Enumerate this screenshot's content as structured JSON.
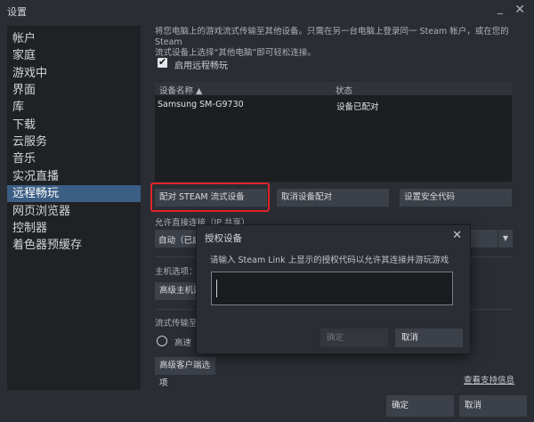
{
  "window": {
    "title": "设置",
    "minimize": "_",
    "close": "✕"
  },
  "sidebar": {
    "items": [
      {
        "label": "帐户"
      },
      {
        "label": "家庭"
      },
      {
        "label": "游戏中"
      },
      {
        "label": "界面"
      },
      {
        "label": "库"
      },
      {
        "label": "下载"
      },
      {
        "label": "云服务"
      },
      {
        "label": "音乐"
      },
      {
        "label": "实况直播"
      },
      {
        "label": "远程畅玩",
        "active": true
      },
      {
        "label": "网页浏览器"
      },
      {
        "label": "控制器"
      },
      {
        "label": "着色器预缓存"
      }
    ]
  },
  "main": {
    "description_line1": "将您电脑上的游戏流式传输至其他设备。只需在另一台电脑上登录同一 Steam 帐户，或在您的 Steam",
    "description_line2": "流式设备上选择“其他电脑”即可轻松连接。",
    "enable_checkbox": {
      "label": "启用远程畅玩",
      "checked_mark": "✔"
    },
    "device_table": {
      "headers": [
        "设备名称 ▲",
        "状态"
      ],
      "rows": [
        {
          "name": "Samsung SM-G9730",
          "status": "设备已配对"
        }
      ]
    },
    "buttons": {
      "pair": "配对 STEAM 流式设备",
      "unpair": "取消设备配对",
      "security_code": "设置安全代码"
    },
    "direct_connect_label": "允许直接连接（IP 共享）",
    "direct_connect_value": "自动（已启",
    "dropdown_arrow": "▼",
    "host_options_label": "主机选项：",
    "advanced_host_button": "高级主机选",
    "stream_to_label": "流式传输至",
    "radio_label": "高速",
    "advanced_client_button": "高级客户端选项",
    "support_link": "查看支持信息"
  },
  "footer": {
    "ok": "确定",
    "cancel": "取消"
  },
  "dialog": {
    "title": "授权设备",
    "close": "✕",
    "prompt": "请输入 Steam Link 上显示的授权代码以允许其连接并游玩游戏",
    "input_value": "",
    "ok": "确定",
    "cancel": "取消"
  }
}
